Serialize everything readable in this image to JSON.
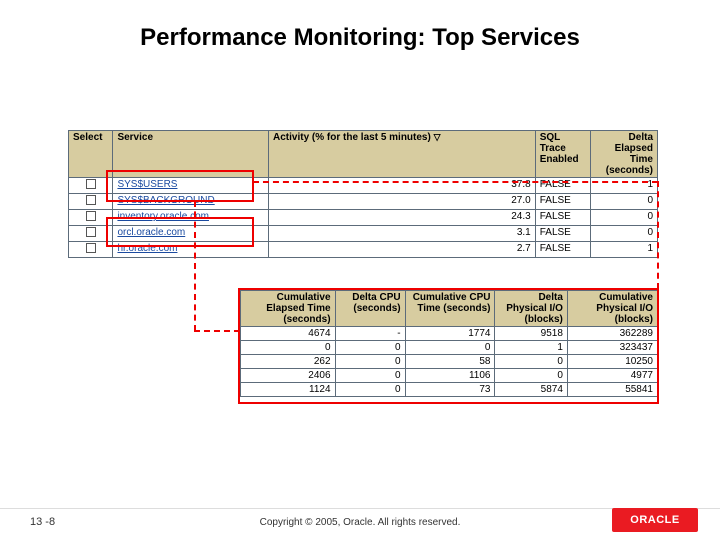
{
  "title": "Performance Monitoring: Top Services",
  "topTable": {
    "headers": {
      "select": "Select",
      "service": "Service",
      "activity": "Activity (% for the last 5 minutes)",
      "sql": "SQL\nTrace\nEnabled",
      "delta": "Delta\nElapsed\nTime\n(seconds)"
    },
    "rows": [
      {
        "service": "SYS$USERS",
        "activity": "37.8",
        "sql": "FALSE",
        "delta": "1"
      },
      {
        "service": "SYS$BACKGROUND",
        "activity": "27.0",
        "sql": "FALSE",
        "delta": "0"
      },
      {
        "service": "inventory.oracle.com",
        "activity": "24.3",
        "sql": "FALSE",
        "delta": "0"
      },
      {
        "service": "orcl.oracle.com",
        "activity": "3.1",
        "sql": "FALSE",
        "delta": "0"
      },
      {
        "service": "hr.oracle.com",
        "activity": "2.7",
        "sql": "FALSE",
        "delta": "1"
      }
    ]
  },
  "bottomTable": {
    "headers": {
      "cumElapsed": "Cumulative\nElapsed\nTime\n(seconds)",
      "deltaCpu": "Delta CPU\n(seconds)",
      "cumCpu": "Cumulative\nCPU Time\n(seconds)",
      "deltaIo": "Delta\nPhysical\nI/O\n(blocks)",
      "cumIo": "Cumulative\nPhysical\nI/O (blocks)"
    },
    "rows": [
      {
        "v": [
          "4674",
          "-",
          "1774",
          "9518",
          "362289"
        ]
      },
      {
        "v": [
          "0",
          "0",
          "0",
          "1",
          "323437"
        ]
      },
      {
        "v": [
          "262",
          "0",
          "58",
          "0",
          "10250"
        ]
      },
      {
        "v": [
          "2406",
          "0",
          "1106",
          "0",
          "4977"
        ]
      },
      {
        "v": [
          "1124",
          "0",
          "73",
          "5874",
          "55841"
        ]
      }
    ]
  },
  "footer": {
    "page": "13 -8",
    "copyright": "Copyright © 2005, Oracle. All rights reserved.",
    "logoText": "ORACLE"
  }
}
